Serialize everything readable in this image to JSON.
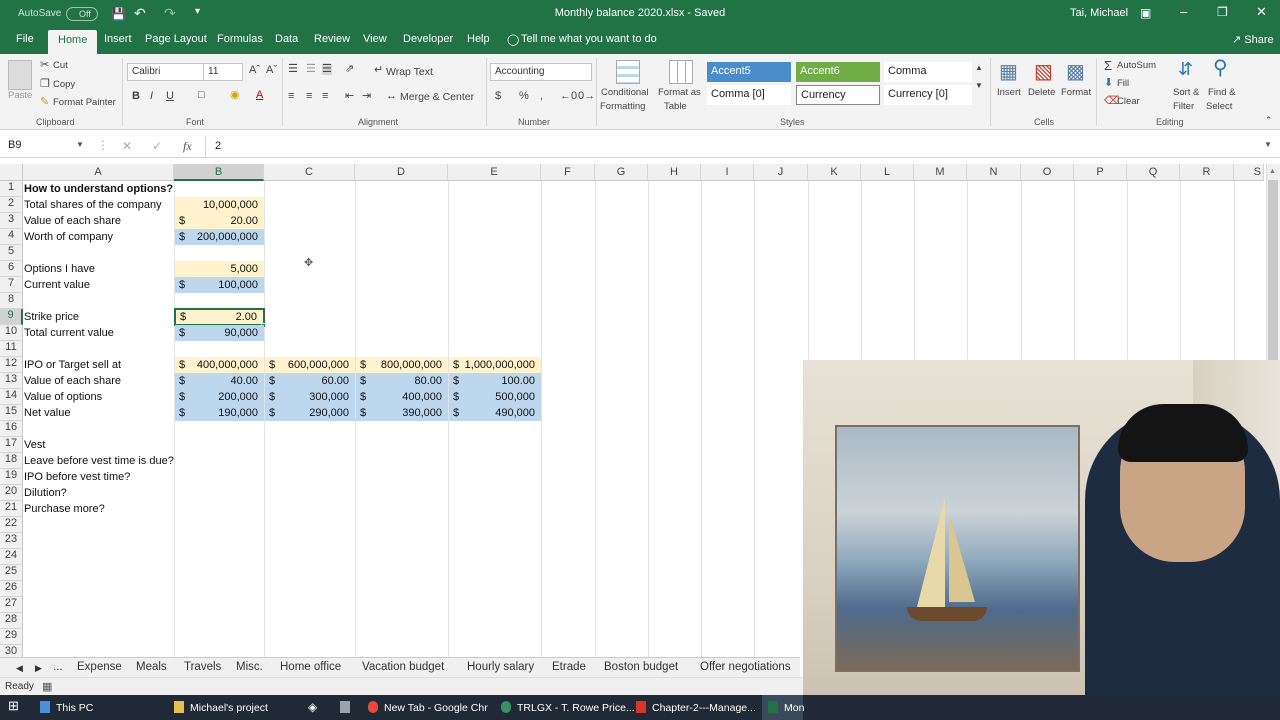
{
  "titlebar": {
    "autosave_label": "AutoSave",
    "autosave_state": "Off",
    "title": "Monthly balance 2020.xlsx  -  Saved",
    "user": "Tai, Michael"
  },
  "ribbon_tabs": [
    "File",
    "Home",
    "Insert",
    "Page Layout",
    "Formulas",
    "Data",
    "Review",
    "View",
    "Developer",
    "Help"
  ],
  "tell_me": "Tell me what you want to do",
  "share": "Share",
  "clipboard": {
    "paste": "Paste",
    "cut": "Cut",
    "copy": "Copy",
    "format_painter": "Format Painter",
    "group": "Clipboard"
  },
  "font": {
    "name": "Calibri",
    "size": "11",
    "group": "Font"
  },
  "alignment": {
    "wrap": "Wrap Text",
    "merge": "Merge & Center",
    "group": "Alignment"
  },
  "number": {
    "format": "Accounting",
    "group": "Number"
  },
  "styles": {
    "conditional": "Conditional",
    "formatting": "Formatting",
    "format_as": "Format as",
    "table": "Table",
    "group": "Styles",
    "cells": [
      "Accent5",
      "Accent6",
      "Comma",
      "Comma [0]",
      "Currency",
      "Currency [0]"
    ]
  },
  "cells_group": {
    "insert": "Insert",
    "delete": "Delete",
    "format": "Format",
    "group": "Cells"
  },
  "editing": {
    "autosum": "AutoSum",
    "fill": "Fill",
    "clear": "Clear",
    "sort": "Sort &",
    "filter": "Filter",
    "find": "Find &",
    "select": "Select",
    "group": "Editing"
  },
  "formula_bar": {
    "name_box": "B9",
    "fx": "fx",
    "value": "2"
  },
  "columns": [
    "A",
    "B",
    "C",
    "D",
    "E",
    "F",
    "G",
    "H",
    "I",
    "J",
    "K",
    "L",
    "M",
    "N",
    "O",
    "P",
    "Q",
    "R",
    "S"
  ],
  "rows": [
    "1",
    "2",
    "3",
    "4",
    "5",
    "6",
    "7",
    "8",
    "9",
    "10",
    "11",
    "12",
    "13",
    "14",
    "15",
    "16",
    "17",
    "18",
    "19",
    "20",
    "21",
    "22",
    "23",
    "24",
    "25",
    "26",
    "27",
    "28",
    "29",
    "30"
  ],
  "sheet": {
    "a1": "How to understand options?",
    "a2": "Total shares of the company",
    "b2": "10,000,000",
    "a3": "Value of each share",
    "b3": "20.00",
    "a4": "Worth of company",
    "b4": "200,000,000",
    "a6": "Options I have",
    "b6": "5,000",
    "a7": "Current value",
    "b7": "100,000",
    "a9": "Strike price",
    "b9": "2.00",
    "a10": "Total current value",
    "b10": "90,000",
    "a12": "IPO or Target sell at",
    "b12": "400,000,000",
    "c12": "600,000,000",
    "d12": "800,000,000",
    "e12": "1,000,000,000",
    "a13": "Value of each share",
    "b13": "40.00",
    "c13": "60.00",
    "d13": "80.00",
    "e13": "100.00",
    "a14": "Value of options",
    "b14": "200,000",
    "c14": "300,000",
    "d14": "400,000",
    "e14": "500,000",
    "a15": "Net value",
    "b15": "190,000",
    "c15": "290,000",
    "d15": "390,000",
    "e15": "490,000",
    "a17": "Vest",
    "a18": "Leave before vest time is due?",
    "a19": "IPO before vest time?",
    "a20": "Dilution?",
    "a21": "Purchase more?",
    "dollar": "$"
  },
  "sheet_tabs": [
    "...",
    "Expense",
    "Meals",
    "Travels",
    "Misc.",
    "Home office",
    "Vacation budget",
    "Hourly salary",
    "Etrade",
    "Boston budget",
    "Offer negotiations"
  ],
  "status": "Ready",
  "taskbar": [
    "This PC",
    "Michael's project",
    "New Tab - Google Chr",
    "TRLGX - T. Rowe Price...",
    "Chapter-2---Manage...",
    "Mon"
  ]
}
